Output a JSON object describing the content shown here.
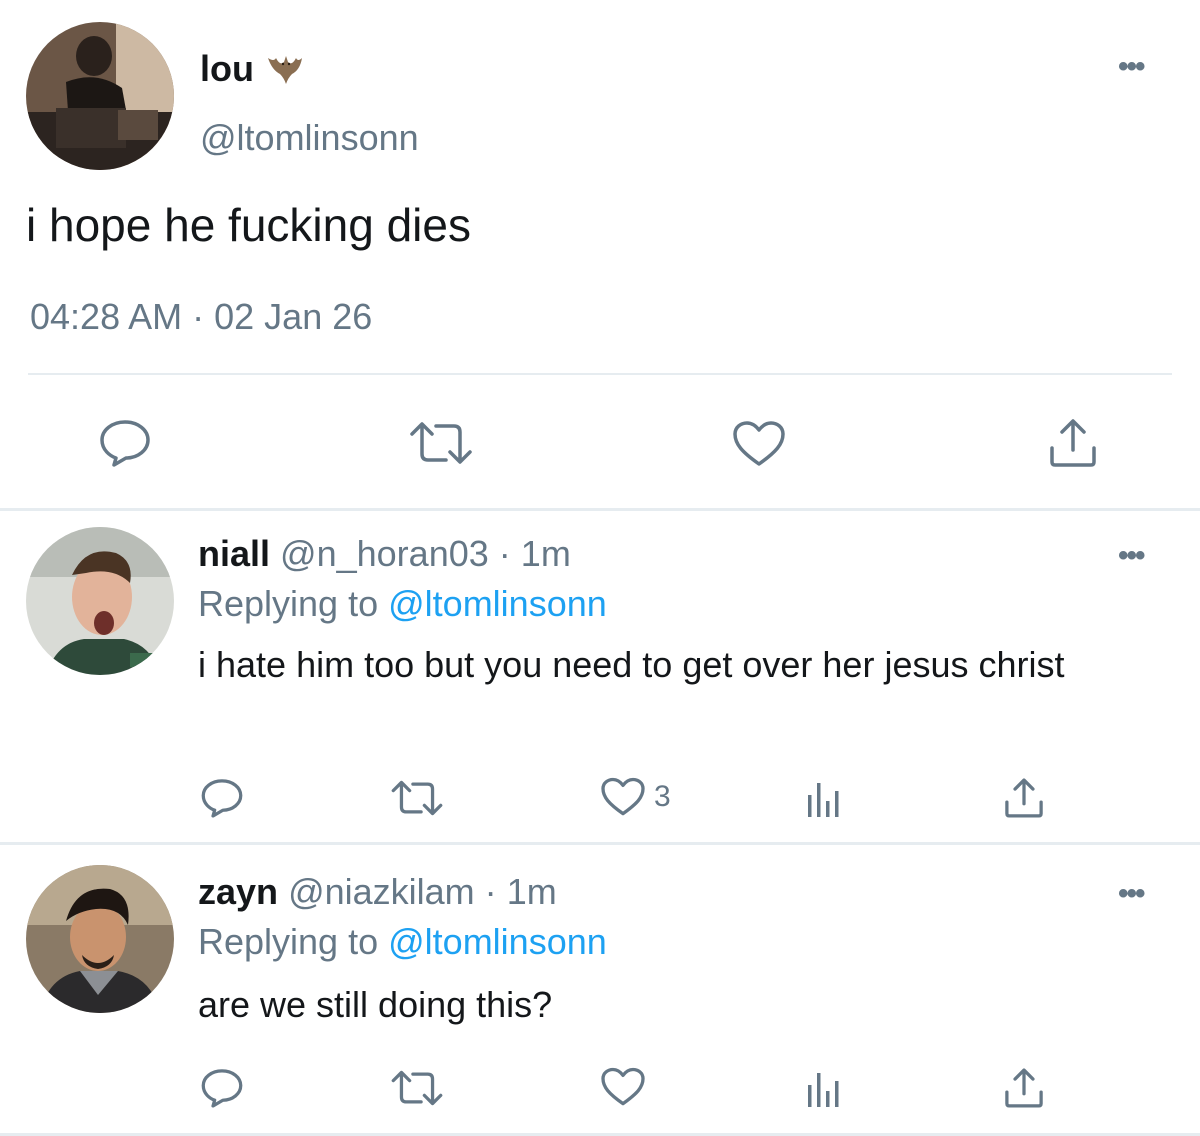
{
  "main_tweet": {
    "name": "lou",
    "name_emoji": "bat",
    "handle": "@ltomlinsonn",
    "text": "i hope he fucking dies",
    "time": "04:28 AM",
    "separator": "·",
    "date": "02 Jan 26",
    "more": "•••"
  },
  "replies": [
    {
      "name": "niall",
      "handle": "@n_horan03",
      "separator": "·",
      "age": "1m",
      "replying_prefix": "Replying to",
      "replying_to": "@ltomlinsonn",
      "text": "i hate him too but you need to get over her jesus christ",
      "like_count": "3",
      "more": "•••"
    },
    {
      "name": "zayn",
      "handle": "@niazkilam",
      "separator": "·",
      "age": "1m",
      "replying_prefix": "Replying to",
      "replying_to": "@ltomlinsonn",
      "text": "are we still doing this?",
      "like_count": "",
      "more": "•••"
    }
  ],
  "colors": {
    "text": "#14171a",
    "secondary": "#657786",
    "link": "#1da1f2",
    "divider": "#e6ecf0"
  }
}
